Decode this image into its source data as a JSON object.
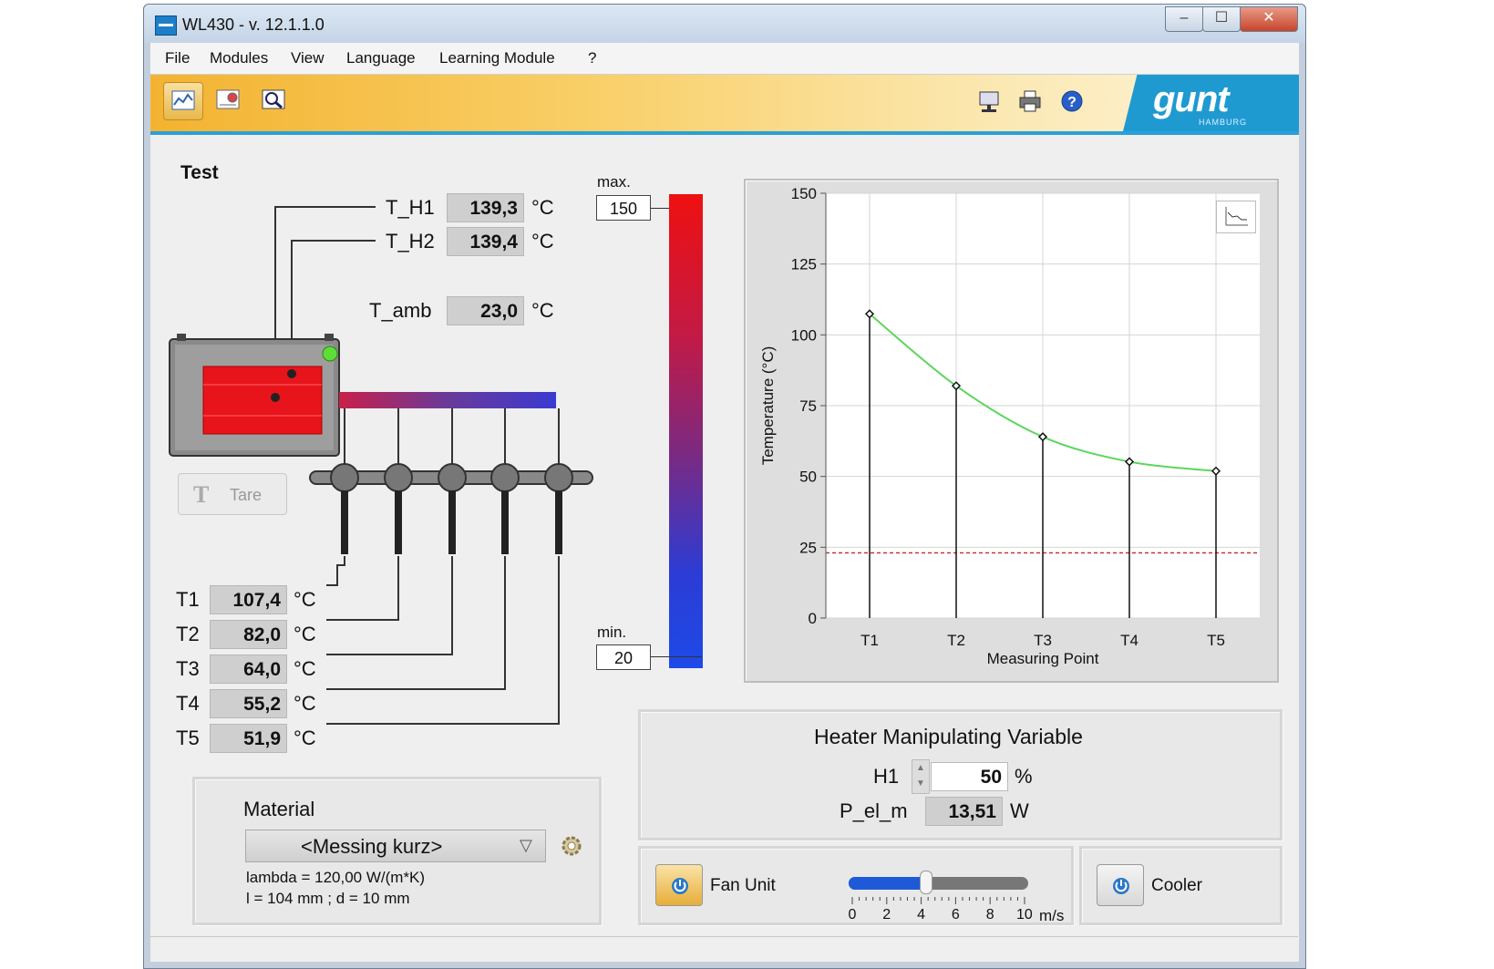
{
  "window": {
    "title": "WL430 - v. 12.1.1.0",
    "minimize": "–",
    "maximize": "☐",
    "close": "✕"
  },
  "menu": [
    "File",
    "Modules",
    "View",
    "Language",
    "Learning Module",
    "?"
  ],
  "toolbar": {
    "left_icons": [
      "chart-view-icon",
      "experiment-view-icon",
      "zoom-chart-icon"
    ],
    "right_icons": [
      "network-icon",
      "print-icon",
      "help-icon"
    ],
    "logo": "gunt",
    "logo_sub": "HAMBURG"
  },
  "test": {
    "title": "Test",
    "heaters": [
      {
        "label": "T_H1",
        "value": "139,3",
        "unit": "°C"
      },
      {
        "label": "T_H2",
        "value": "139,4",
        "unit": "°C"
      }
    ],
    "ambient": {
      "label": "T_amb",
      "value": "23,0",
      "unit": "°C"
    },
    "tare_label": "Tare",
    "sensors": [
      {
        "label": "T1",
        "value": "107,4",
        "unit": "°C"
      },
      {
        "label": "T2",
        "value": "82,0",
        "unit": "°C"
      },
      {
        "label": "T3",
        "value": "64,0",
        "unit": "°C"
      },
      {
        "label": "T4",
        "value": "55,2",
        "unit": "°C"
      },
      {
        "label": "T5",
        "value": "51,9",
        "unit": "°C"
      }
    ]
  },
  "scale": {
    "max_label": "max.",
    "max_value": "150",
    "min_label": "min.",
    "min_value": "20"
  },
  "material": {
    "title": "Material",
    "selected": "<Messing kurz>",
    "lambda": "lambda = 120,00 W/(m*K)",
    "dims": "l = 104 mm ; d = 10 mm"
  },
  "heater": {
    "title": "Heater Manipulating Variable",
    "h1_label": "H1",
    "h1_value": "50",
    "h1_unit": "%",
    "pel_label": "P_el_m",
    "pel_value": "13,51",
    "pel_unit": "W"
  },
  "fan": {
    "label": "Fan Unit",
    "ticks": [
      "0",
      "2",
      "4",
      "6",
      "8",
      "10"
    ],
    "unit": "m/s",
    "value_ms": 4.3,
    "max_ms": 10
  },
  "cooler": {
    "label": "Cooler"
  },
  "colors": {
    "accent_blue": "#1f9ad1",
    "curve": "#5cd65c",
    "ambient_line": "#cc3333",
    "heater_red": "#e8141c"
  },
  "chart_data": {
    "type": "line",
    "categories": [
      "T1",
      "T2",
      "T3",
      "T4",
      "T5"
    ],
    "values": [
      107.4,
      82.0,
      64.0,
      55.2,
      51.9
    ],
    "reference_line": 23.0,
    "xlabel": "Measuring Point",
    "ylabel": "Temperature (°C)",
    "ylim": [
      0,
      150
    ],
    "yticks": [
      0,
      25,
      50,
      75,
      100,
      125,
      150
    ],
    "grid": true
  }
}
